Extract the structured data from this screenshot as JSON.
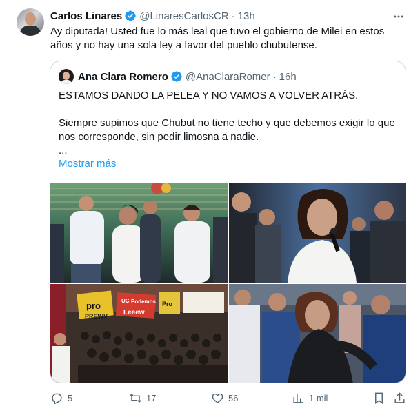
{
  "tweet": {
    "author_name": "Carlos Linares",
    "author_handle": "@LinaresCarlosCR",
    "separator": "·",
    "time": "13h",
    "text": "Ay diputada! Usted fue lo más leal que tuvo el gobierno de Milei en estos años y no hay una sola ley a favor del pueblo  chubutense.",
    "verified_icon": "verified-badge-icon",
    "more_icon": "more-options-icon"
  },
  "quote": {
    "author_name": "Ana Clara Romero",
    "author_handle": "@AnaClaraRomer",
    "separator": "·",
    "time": "16h",
    "lines": [
      "ESTAMOS DANDO LA PELEA Y NO VAMOS A VOLVER ATRÁS.",
      "",
      "Siempre supimos que Chubut no tiene techo y que debemos exigir lo que nos corresponde, sin pedir limosna a nadie.",
      "..."
    ],
    "show_more": "Mostrar más",
    "banner_texts": [
      "pro",
      "PREWV",
      "Pro",
      "Podemos",
      "UC",
      "Leeew"
    ]
  },
  "actions": {
    "replies": "5",
    "retweets": "17",
    "likes": "56",
    "views": "1 mil"
  },
  "colors": {
    "text": "#0f1419",
    "secondary": "#536471",
    "accent": "#1d9bf0",
    "border": "#cfd9de"
  }
}
